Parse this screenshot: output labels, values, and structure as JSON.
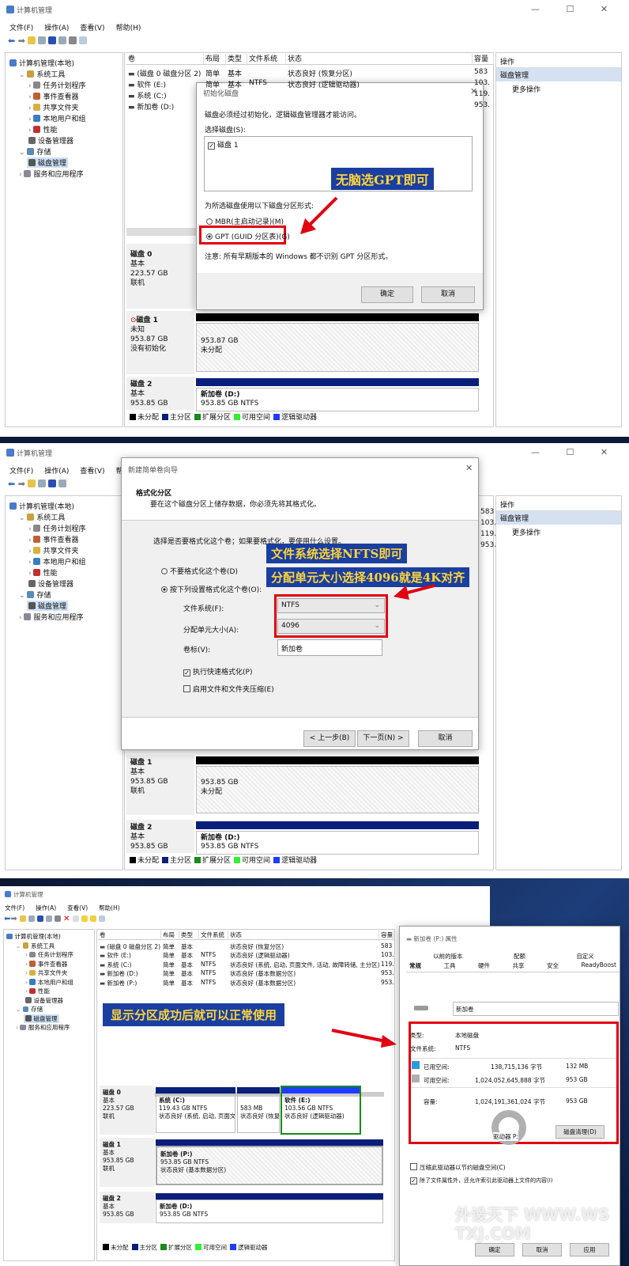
{
  "window": {
    "title": "计算机管理",
    "menu": [
      "文件(F)",
      "操作(A)",
      "查看(V)",
      "帮助(H)"
    ],
    "controls": [
      "—",
      "☐",
      "✕"
    ]
  },
  "tree": [
    {
      "label": "计算机管理(本地)",
      "level": 0
    },
    {
      "label": "系统工具",
      "level": 1
    },
    {
      "label": "任务计划程序",
      "level": 2
    },
    {
      "label": "事件查看器",
      "level": 2
    },
    {
      "label": "共享文件夹",
      "level": 2
    },
    {
      "label": "本地用户和组",
      "level": 2
    },
    {
      "label": "性能",
      "level": 2
    },
    {
      "label": "设备管理器",
      "level": 2
    },
    {
      "label": "存储",
      "level": 1
    },
    {
      "label": "磁盘管理",
      "level": 2,
      "selected": true
    },
    {
      "label": "服务和应用程序",
      "level": 1
    }
  ],
  "columns": [
    "卷",
    "布局",
    "类型",
    "文件系统",
    "状态",
    "容量"
  ],
  "volumes_before": [
    [
      "(磁盘 0 磁盘分区 2)",
      "简单",
      "基本",
      "",
      "状态良好 (恢复分区)",
      "583"
    ],
    [
      "软件 (E:)",
      "简单",
      "基本",
      "NTFS",
      "状态良好 (逻辑驱动器)",
      "103."
    ],
    [
      "系统 (C:)",
      "",
      "",
      "",
      "",
      "119."
    ],
    [
      "新加卷 (D:)",
      "",
      "",
      "",
      "",
      "953."
    ]
  ],
  "volumes_after": [
    [
      "(磁盘 0 磁盘分区 2)",
      "简单",
      "基本",
      "",
      "状态良好 (恢复分区)",
      "583"
    ],
    [
      "软件 (E:)",
      "简单",
      "基本",
      "NTFS",
      "状态良好 (逻辑驱动器)",
      "103."
    ],
    [
      "系统 (C:)",
      "简单",
      "基本",
      "NTFS",
      "状态良好 (系统, 启动, 页面文件, 活动, 故障转储, 主分区)",
      "119."
    ],
    [
      "新加卷 (D:)",
      "简单",
      "基本",
      "NTFS",
      "状态良好 (基本数据分区)",
      "953."
    ],
    [
      "新加卷 (P:)",
      "简单",
      "基本",
      "NTFS",
      "状态良好 (基本数据分区)",
      "953."
    ]
  ],
  "actions": {
    "header": "操作",
    "section": "磁盘管理",
    "more": "更多操作"
  },
  "disks": {
    "disk0": {
      "name": "磁盘 0",
      "type": "基本",
      "size": "223.57 GB",
      "status": "联机"
    },
    "disk1_uninit": {
      "name": "磁盘 1",
      "type": "未知",
      "size": "953.87 GB",
      "status": "没有初始化",
      "part_size": "953.87 GB",
      "part_status": "未分配"
    },
    "disk1_unalloc": {
      "name": "磁盘 1",
      "type": "基本",
      "size": "953.85 GB",
      "status": "联机",
      "part_size": "953.85 GB",
      "part_status": "未分配"
    },
    "disk1_done": {
      "name": "磁盘 1",
      "type": "基本",
      "size": "953.85 GB",
      "status": "联机",
      "part_name": "新加卷 (P:)",
      "part_size": "953.85 GB NTFS",
      "part_status": "状态良好 (基本数据分区)"
    },
    "disk2": {
      "name": "磁盘 2",
      "type": "基本",
      "size": "953.85 GB",
      "part_name": "新加卷 (D:)",
      "part_size": "953.85 GB NTFS"
    },
    "disk0_parts": [
      {
        "name": "系统 (C:)",
        "size": "119.43 GB NTFS",
        "status": "状态良好 (系统, 启动, 页面文"
      },
      {
        "name": "",
        "size": "583 MB",
        "status": "状态良好 (恢复"
      },
      {
        "name": "软件 (E:)",
        "size": "103.56 GB NTFS",
        "status": "状态良好 (逻辑驱动器)"
      }
    ]
  },
  "legend": [
    {
      "label": "未分配",
      "color": "#000000"
    },
    {
      "label": "主分区",
      "color": "#0a1f7a"
    },
    {
      "label": "扩展分区",
      "color": "#1a8a1a"
    },
    {
      "label": "可用空间",
      "color": "#33ee33"
    },
    {
      "label": "逻辑驱动器",
      "color": "#1e3cff"
    }
  ],
  "init_dialog": {
    "title": "初始化磁盘",
    "message": "磁盘必须经过初始化，逻辑磁盘管理器才能访问。",
    "select_label": "选择磁盘(S):",
    "disk_item": "磁盘 1",
    "style_label": "为所选磁盘使用以下磁盘分区形式:",
    "mbr": "MBR(主启动记录)(M)",
    "gpt": "GPT (GUID 分区表)(G)",
    "note": "注意: 所有早期版本的 Windows 都不识别 GPT 分区形式。",
    "ok": "确定",
    "cancel": "取消",
    "annotation": "无脑选GPT即可"
  },
  "wizard": {
    "title": "新建简单卷向导",
    "heading": "格式化分区",
    "subheading": "要在这个磁盘分区上储存数据，你必须先将其格式化。",
    "prompt": "选择是否要格式化这个卷；如果要格式化，要使用什么设置。",
    "no_format": "不要格式化这个卷(D)",
    "format": "按下列设置格式化这个卷(O):",
    "fs_label": "文件系统(F):",
    "fs_value": "NTFS",
    "au_label": "分配单元大小(A):",
    "au_value": "4096",
    "vol_label": "卷标(V):",
    "vol_value": "新加卷",
    "quick": "执行快速格式化(P)",
    "compress": "启用文件和文件夹压缩(E)",
    "back": "< 上一步(B)",
    "next": "下一页(N) >",
    "cancel": "取消",
    "annotation1": "文件系统选择NFTS即可",
    "annotation2": "分配单元大小选择4096就是4K对齐"
  },
  "props": {
    "title": "新加卷 (P:) 属性",
    "tabs_row1": [
      "以前的版本",
      "配额",
      "自定义"
    ],
    "tabs_row2": [
      "常规",
      "工具",
      "硬件",
      "共享",
      "安全",
      "ReadyBoost"
    ],
    "name": "新加卷",
    "type_label": "类型:",
    "type_value": "本地磁盘",
    "fs_label": "文件系统:",
    "fs_value": "NTFS",
    "used_label": "已用空间:",
    "used_bytes": "138,715,136 字节",
    "used_size": "132 MB",
    "free_label": "可用空间:",
    "free_bytes": "1,024,052,645,888 字节",
    "free_size": "953 GB",
    "cap_label": "容量:",
    "cap_bytes": "1,024,191,361,024 字节",
    "cap_size": "953 GB",
    "used_color": "#2b9be0",
    "free_color": "#b0b0b0",
    "drive_label": "驱动器 P:",
    "cleanup": "磁盘清理(D)",
    "compress": "压缩此驱动器以节约磁盘空间(C)",
    "index": "除了文件属性外，还允许索引此驱动器上文件的内容(I)",
    "ok": "确定",
    "cancel": "取消",
    "apply": "应用"
  },
  "result_annotation": "显示分区成功后就可以正常使用",
  "watermark": "外设天下 WWW.WSTXJ.COM"
}
